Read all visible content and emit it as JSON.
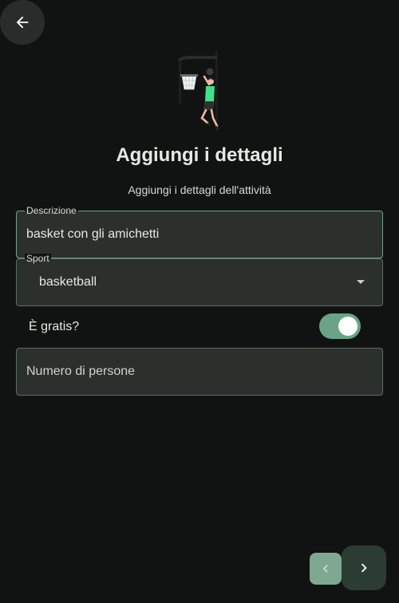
{
  "header": {
    "back_icon": "arrow-left-icon",
    "illustration": "basketball-player-illustration"
  },
  "page": {
    "title": "Aggiungi i dettagli",
    "subtitle": "Aggiungi i dettagli dell'attività"
  },
  "form": {
    "description": {
      "label": "Descrizione",
      "value": "basket con gli amichetti"
    },
    "sport": {
      "label": "Sport",
      "value": "basketball",
      "icon": "dropdown-arrow-icon"
    },
    "free": {
      "label": "È gratis?",
      "checked": true
    },
    "people": {
      "placeholder": "Numero di persone",
      "value": ""
    }
  },
  "nav": {
    "prev_icon": "chevron-left-icon",
    "next_icon": "chevron-right-icon"
  },
  "colors": {
    "background": "#111312",
    "field_background": "#2b302d",
    "accent": "#6aa387",
    "next_button": "#2b3d33"
  }
}
